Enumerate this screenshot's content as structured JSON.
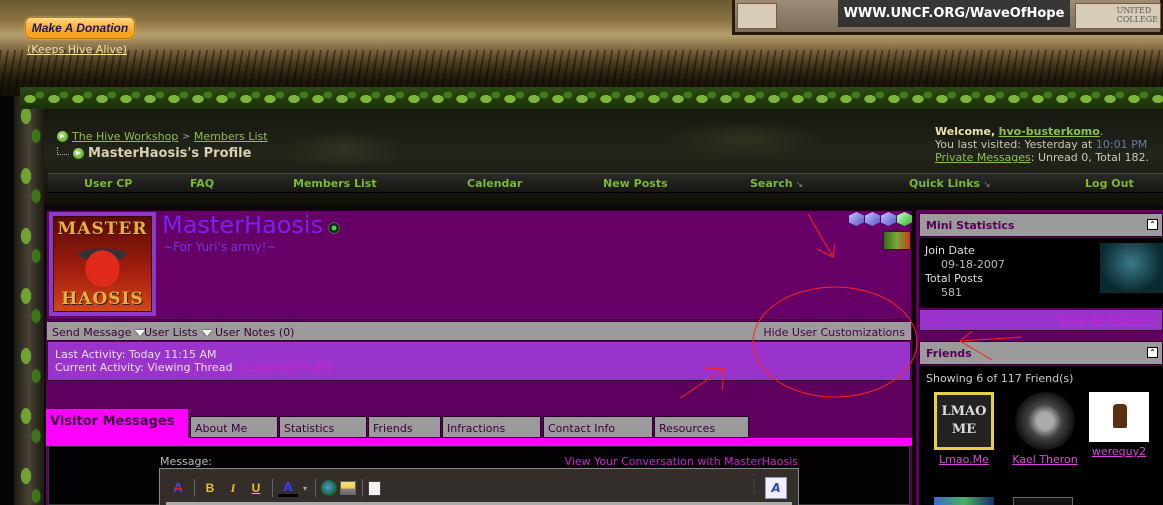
{
  "header": {
    "donate_button": "Make A Donation",
    "donate_sub": "(Keeps Hive Alive)",
    "banner_text": "WWW.UNCF.ORG/WaveOfHope",
    "banner_college": "UNITED\nCOLLEGE"
  },
  "breadcrumb": {
    "items": [
      "The Hive Workshop",
      "Members List"
    ],
    "separator": ">",
    "current": "MasterHaosis's Profile"
  },
  "welcome": {
    "greeting": "Welcome,",
    "username": "hvo-busterkomo",
    "last_visit_prefix": "You last visited: Yesterday at",
    "last_visit_time": "10:01 PM",
    "pm_label": "Private Messages",
    "pm_status": ": Unread 0, Total 182."
  },
  "navbar": {
    "items": [
      {
        "label": "User CP"
      },
      {
        "label": "FAQ"
      },
      {
        "label": "Members List"
      },
      {
        "label": "Calendar"
      },
      {
        "label": "New Posts"
      },
      {
        "label": "Search",
        "dropdown": true
      },
      {
        "label": "Quick Links",
        "dropdown": true
      },
      {
        "label": "Log Out"
      }
    ]
  },
  "profile": {
    "avatar_text_top": "MASTER",
    "avatar_text_bottom": "HAOSIS",
    "username": "MasterHaosis",
    "user_title": "~For Yuri's army!~",
    "online_status": "online",
    "rank_gems": [
      "blue",
      "blue",
      "blue",
      "green"
    ],
    "actions": {
      "send_message": "Send Message",
      "user_lists": "User Lists",
      "user_notes": "User Notes (0)",
      "hide_customizations": "Hide User Customizations"
    },
    "last_activity": "Last Activity: Today 11:15 AM",
    "current_activity": "Current Activity: Viewing Thread",
    "customize_link": "Customize Profile"
  },
  "tabs": [
    {
      "label": "Visitor Messages",
      "active": true
    },
    {
      "label": "About Me"
    },
    {
      "label": "Statistics"
    },
    {
      "label": "Friends"
    },
    {
      "label": "Infractions"
    },
    {
      "label": "Contact Info"
    },
    {
      "label": "Resources"
    }
  ],
  "visitor_messages": {
    "message_label": "Message:",
    "conversation_link": "View Your Conversation with MasterHaosis",
    "toolbar": {
      "remove_format": "A",
      "bold": "B",
      "italic": "I",
      "underline": "U",
      "font_color": "A",
      "color_caret": "▾",
      "switch_mode": "A"
    }
  },
  "sidebar": {
    "mini_stats": {
      "title": "Mini Statistics",
      "join_date_label": "Join Date",
      "join_date": "09-18-2007",
      "total_posts_label": "Total Posts",
      "total_posts": "581",
      "show_all": "Show All Statistics"
    },
    "friends": {
      "title": "Friends",
      "count_text": "Showing 6 of 117 Friend(s)",
      "items": [
        {
          "name": "Lmao.Me",
          "avatar_text": "LMAO ME"
        },
        {
          "name": "Kael Theron"
        },
        {
          "name": "werequy2"
        }
      ]
    }
  },
  "colors": {
    "profile_bg": "#660066",
    "username": "#7722ee",
    "active_tab": "#ff00ff",
    "nav_link": "#7cb832",
    "activity_bg": "#9933cc",
    "link_magenta": "#cc22cc",
    "annotation_red": "#ff2020"
  }
}
